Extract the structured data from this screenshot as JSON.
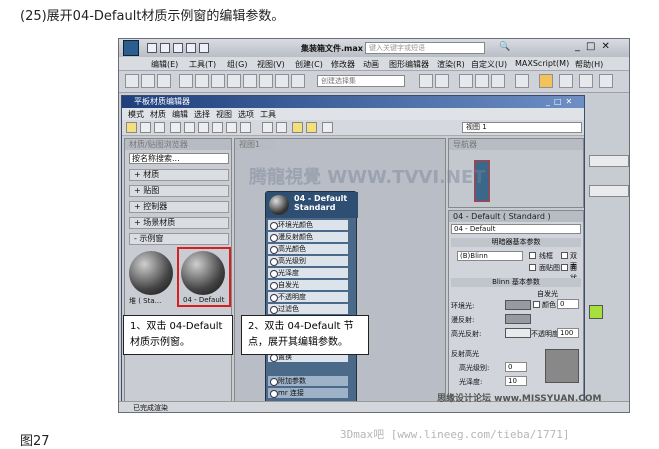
{
  "caption": "(25)展开04-Default材质示例窗的编辑参数。",
  "figure_label": "图27",
  "watermarks": {
    "main": "腾龍視覺 WWW.TVVI.NET",
    "missyuan": "思缘设计论坛 www.MISSYUAN.COM",
    "bottom": "3Dmax吧 [www.lineeg.com/tieba/1771]"
  },
  "app": {
    "title": "集装箱文件.max",
    "search_placeholder": "键入关键字或短语",
    "menu": [
      "编辑(E)",
      "工具(T)",
      "组(G)",
      "视图(V)",
      "创建(C)",
      "修改器",
      "动画",
      "图形编辑器",
      "渲染(R)",
      "自定义(U)",
      "MAXScript(M)",
      "帮助(H)"
    ],
    "selection_set": "创建选择集",
    "status": "已完成渲染"
  },
  "mat_editor": {
    "title": "平板材质编辑器",
    "menu": [
      "模式",
      "材质",
      "编辑",
      "选择",
      "视图",
      "选项",
      "工具"
    ],
    "view_name": "视图 1",
    "browser_header": "材质/贴图浏览器",
    "search_placeholder": "按名称搜索...",
    "categories": [
      "+ 材质",
      "+ 贴图",
      "+ 控制器",
      "+ 场景材质",
      "- 示例窗"
    ],
    "swatches": [
      "堆 ( Sta...",
      "04 - Default"
    ],
    "view_tab": "视图1",
    "navigator": "导航器",
    "node": {
      "title": "04 - Default",
      "subtitle": "Standard",
      "slots": [
        "环境光颜色",
        "漫反射颜色",
        "高光颜色",
        "高光级别",
        "光泽度",
        "自发光",
        "不透明度",
        "过滤色",
        "凹凸",
        "反射",
        "折射",
        "置换",
        "附加参数",
        "mr 连接"
      ]
    },
    "params": {
      "header": "04 - Default ( Standard )",
      "name": "04 - Default",
      "shader_rollout": "明暗器基本参数",
      "shader": "(B)Blinn",
      "checks": [
        "线框",
        "双面",
        "面贴图",
        "面状"
      ],
      "blinn_rollout": "Blinn 基本参数",
      "self_illum": "自发光",
      "color_label": "颜色",
      "color_value": "0",
      "ambient": "环境光:",
      "diffuse": "漫反射:",
      "specular": "高光反射:",
      "opacity_label": "不透明度:",
      "opacity": "100",
      "spec_highlights": "反射高光",
      "spec_level_label": "高光级别:",
      "spec_level": "0",
      "gloss_label": "光泽度:",
      "gloss": "10"
    }
  },
  "callouts": [
    "1、双击 04-Default 材质示例窗。",
    "2、双击 04-Default 节点，展开其编辑参数。"
  ]
}
